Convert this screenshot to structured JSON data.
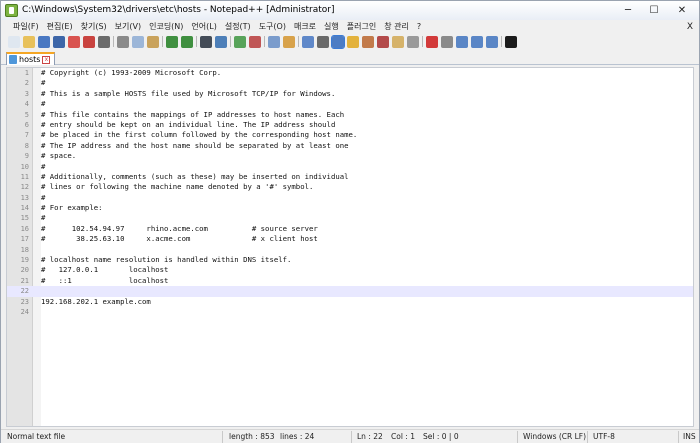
{
  "window": {
    "title": "C:\\Windows\\System32\\drivers\\etc\\hosts - Notepad++ [Administrator]",
    "minimize": "─",
    "maximize": "☐",
    "close": "✕"
  },
  "menu": {
    "items": [
      "파일(F)",
      "편집(E)",
      "찾기(S)",
      "보기(V)",
      "인코딩(N)",
      "언어(L)",
      "설정(T)",
      "도구(O)",
      "매크로",
      "실행",
      "플러그인",
      "창 관리",
      "?"
    ],
    "close": "X"
  },
  "toolbar": {
    "buttons": [
      {
        "name": "new-file-icon",
        "color": "#dfe7f0"
      },
      {
        "name": "open-file-icon",
        "color": "#e8c15b"
      },
      {
        "name": "save-icon",
        "color": "#4a78c2"
      },
      {
        "name": "save-all-icon",
        "color": "#3d66a8"
      },
      {
        "name": "close-icon",
        "color": "#d9534f"
      },
      {
        "name": "close-all-icon",
        "color": "#c9433f"
      },
      {
        "name": "print-icon",
        "color": "#6b6b6b"
      },
      {
        "name": "sep"
      },
      {
        "name": "cut-icon",
        "color": "#8a8a8a"
      },
      {
        "name": "copy-icon",
        "color": "#9cb6d8"
      },
      {
        "name": "paste-icon",
        "color": "#c9a25b"
      },
      {
        "name": "sep"
      },
      {
        "name": "undo-icon",
        "color": "#3f8f3f"
      },
      {
        "name": "redo-icon",
        "color": "#3f8f3f"
      },
      {
        "name": "sep"
      },
      {
        "name": "find-icon",
        "color": "#444c57"
      },
      {
        "name": "replace-icon",
        "color": "#4d7fb8"
      },
      {
        "name": "sep"
      },
      {
        "name": "zoom-in-icon",
        "color": "#58a35a"
      },
      {
        "name": "zoom-out-icon",
        "color": "#c05656"
      },
      {
        "name": "sep"
      },
      {
        "name": "sync-vertical-icon",
        "color": "#7b9ccc"
      },
      {
        "name": "sync-horizontal-icon",
        "color": "#d8a24a"
      },
      {
        "name": "sep"
      },
      {
        "name": "word-wrap-icon",
        "color": "#5f88c9"
      },
      {
        "name": "show-all-chars-icon",
        "color": "#6a6a6a"
      },
      {
        "name": "indent-guide-icon",
        "color": "#4c7cc4",
        "active": true
      },
      {
        "name": "user-language-icon",
        "color": "#e3b23c"
      },
      {
        "name": "doc-map-icon",
        "color": "#c27a4a"
      },
      {
        "name": "function-list-icon",
        "color": "#b34a4a"
      },
      {
        "name": "folder-workspace-icon",
        "color": "#d6b36a"
      },
      {
        "name": "monitoring-icon",
        "color": "#9a9a9a"
      },
      {
        "name": "sep"
      },
      {
        "name": "record-macro-icon",
        "color": "#d23a3a"
      },
      {
        "name": "stop-macro-icon",
        "color": "#8a8a8a"
      },
      {
        "name": "play-macro-icon",
        "color": "#5a86c6"
      },
      {
        "name": "play-macro-multiple-icon",
        "color": "#5a86c6"
      },
      {
        "name": "save-macro-icon",
        "color": "#5a86c6"
      },
      {
        "name": "sep"
      },
      {
        "name": "console-icon",
        "color": "#1b1b1b"
      }
    ]
  },
  "tab": {
    "label": "hosts",
    "close": "x"
  },
  "editor": {
    "current_line": 22,
    "lines": [
      "# Copyright (c) 1993-2009 Microsoft Corp.",
      "#",
      "# This is a sample HOSTS file used by Microsoft TCP/IP for Windows.",
      "#",
      "# This file contains the mappings of IP addresses to host names. Each",
      "# entry should be kept on an individual line. The IP address should",
      "# be placed in the first column followed by the corresponding host name.",
      "# The IP address and the host name should be separated by at least one",
      "# space.",
      "#",
      "# Additionally, comments (such as these) may be inserted on individual",
      "# lines or following the machine name denoted by a '#' symbol.",
      "#",
      "# For example:",
      "#",
      "#      102.54.94.97     rhino.acme.com          # source server",
      "#       38.25.63.10     x.acme.com              # x client host",
      "",
      "# localhost name resolution is handled within DNS itself.",
      "#   127.0.0.1       localhost",
      "#   ::1             localhost",
      "",
      "192.168.202.1 example.com",
      ""
    ]
  },
  "status": {
    "type": "Normal text file",
    "length": "length : 853",
    "lines": "lines : 24",
    "ln": "Ln : 22",
    "col": "Col : 1",
    "sel": "Sel : 0 | 0",
    "eol": "Windows (CR LF)",
    "encoding": "UTF-8",
    "mode": "INS"
  }
}
